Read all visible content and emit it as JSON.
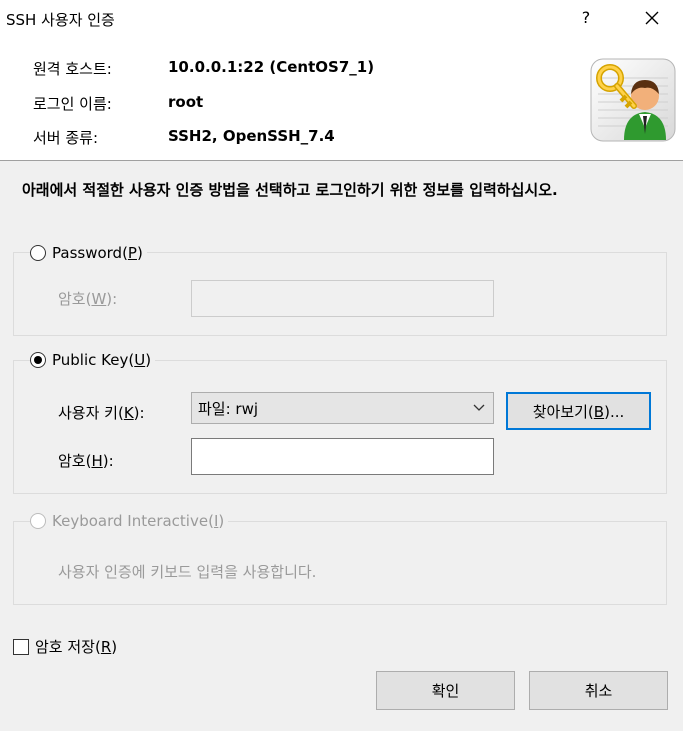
{
  "window": {
    "title": "SSH 사용자 인증",
    "help_label": "?"
  },
  "info": {
    "host_label": "원격 호스트:",
    "host_value": "10.0.0.1:22 (CentOS7_1)",
    "login_label": "로그인 이름:",
    "login_value": "root",
    "server_label": "서버 종류:",
    "server_value": "SSH2, OpenSSH_7.4"
  },
  "instructions": "아래에서 적절한 사용자 인증 방법을 선택하고 로그인하기 위한 정보를 입력하십시오.",
  "password_group": {
    "radio_label_pre": "Password(",
    "radio_label_key": "P",
    "radio_label_post": ")",
    "checked": false,
    "field_label_pre": "암호(",
    "field_label_key": "W",
    "field_label_post": "):",
    "field_value": ""
  },
  "publickey_group": {
    "radio_label_pre": "Public Key(",
    "radio_label_key": "U",
    "radio_label_post": ")",
    "checked": true,
    "userkey_label_pre": "사용자 키(",
    "userkey_label_key": "K",
    "userkey_label_post": "):",
    "userkey_value": "파일: rwj",
    "browse_label_pre": "찾아보기(",
    "browse_label_key": "B",
    "browse_label_post": ")...",
    "passphrase_label_pre": "암호(",
    "passphrase_label_key": "H",
    "passphrase_label_post": "):",
    "passphrase_value": ""
  },
  "keyboard_group": {
    "radio_label_pre": "Keyboard Interactive(",
    "radio_label_key": "I",
    "radio_label_post": ")",
    "checked": false,
    "description": "사용자 인증에 키보드 입력을 사용합니다."
  },
  "save_password": {
    "label_pre": "암호 저장(",
    "label_key": "R",
    "label_post": ")",
    "checked": false
  },
  "buttons": {
    "ok": "확인",
    "cancel": "취소"
  }
}
